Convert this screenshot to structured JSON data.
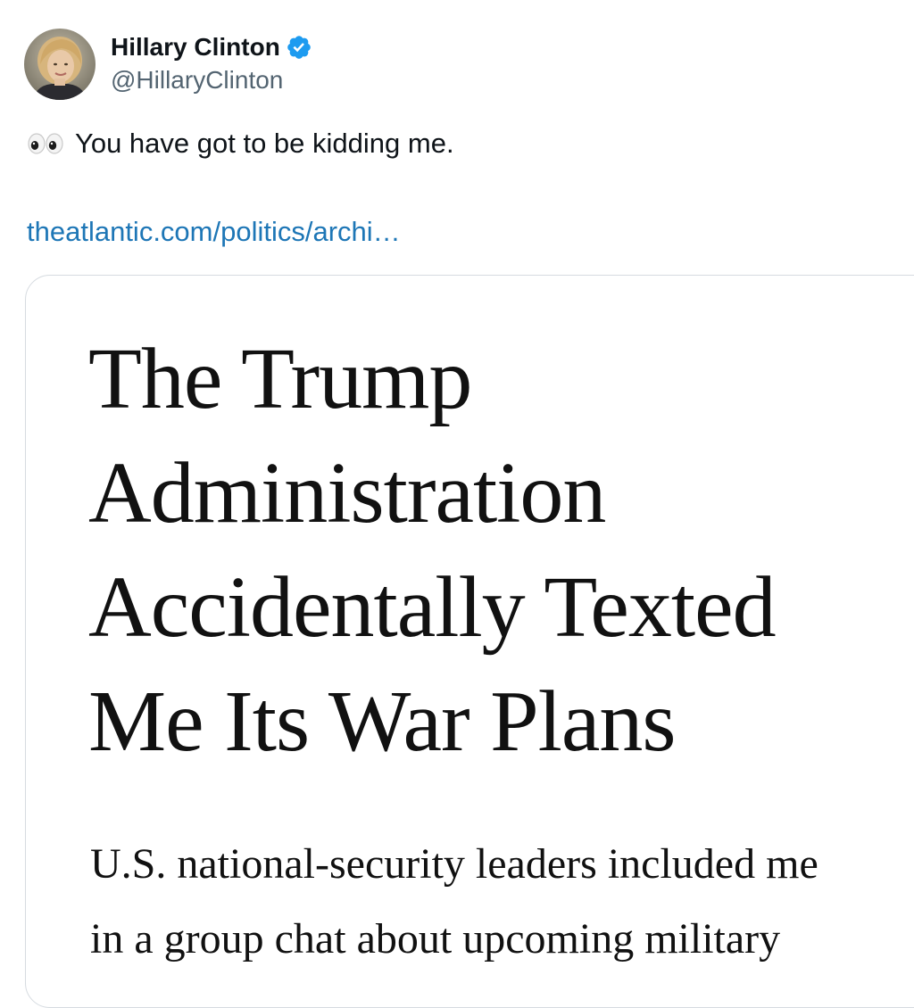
{
  "author": {
    "display_name": "Hillary Clinton",
    "handle": "@HillaryClinton",
    "avatar_icon": "profile-photo",
    "verified_icon": "verified-badge-icon",
    "verified_color": "#1d9bf0"
  },
  "tweet": {
    "emoji_icon": "eyes-emoji-icon",
    "text": "You have got to be kidding me.",
    "link_text": "theatlantic.com/politics/archi…",
    "link_color": "#1d76b6"
  },
  "card": {
    "headline_lines": [
      "The Trump",
      "Administration",
      "Accidentally Texted",
      "Me Its War Plans"
    ],
    "deck_lines": [
      "U.S. national-security leaders included me",
      "in a group chat about upcoming military"
    ]
  }
}
